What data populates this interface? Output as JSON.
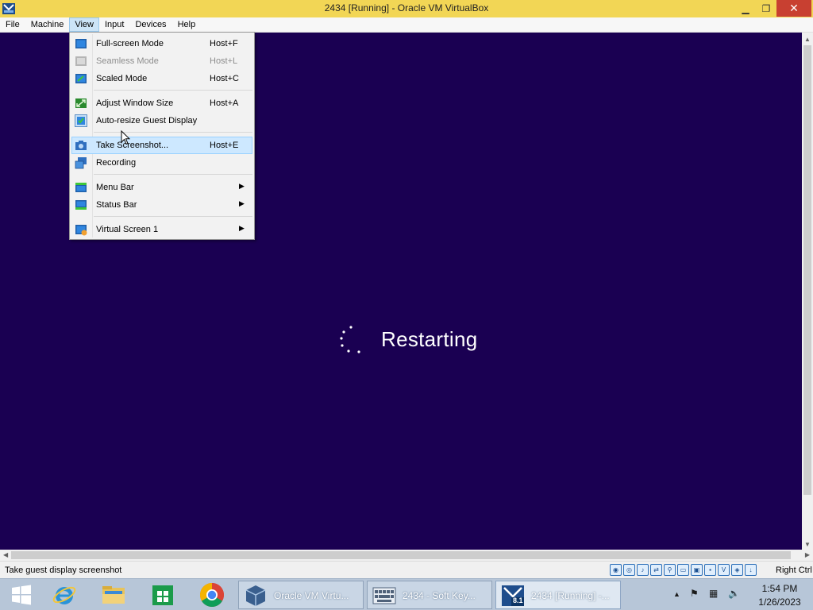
{
  "window": {
    "title": "2434 [Running] - Oracle VM VirtualBox",
    "minimize": "▁",
    "maximize": "❐",
    "close": "✕"
  },
  "menubar": {
    "items": [
      "File",
      "Machine",
      "View",
      "Input",
      "Devices",
      "Help"
    ],
    "active": "View"
  },
  "view_menu": {
    "fullscreen": {
      "label": "Full-screen Mode",
      "shortcut": "Host+F"
    },
    "seamless": {
      "label": "Seamless Mode",
      "shortcut": "Host+L"
    },
    "scaled": {
      "label": "Scaled Mode",
      "shortcut": "Host+C"
    },
    "adjust": {
      "label": "Adjust Window Size",
      "shortcut": "Host+A"
    },
    "autoresize": {
      "label": "Auto-resize Guest Display"
    },
    "screenshot": {
      "label": "Take Screenshot...",
      "shortcut": "Host+E"
    },
    "recording": {
      "label": "Recording"
    },
    "menu_bar": {
      "label": "Menu Bar"
    },
    "status_bar": {
      "label": "Status Bar"
    },
    "virtual_screen": {
      "label": "Virtual Screen 1"
    },
    "submenu_arrow": "▶"
  },
  "guest": {
    "message": "Restarting",
    "background": "#1a0052"
  },
  "statusbar": {
    "text": "Take guest display screenshot",
    "host_key": "Right Ctrl"
  },
  "taskbar": {
    "tasks": [
      {
        "label": "Oracle VM Virtu..."
      },
      {
        "label": "2434 - Soft Key..."
      },
      {
        "label": "2434 [Running] -..."
      }
    ],
    "clock_time": "1:54 PM",
    "clock_date": "1/26/2023",
    "vbox_badge": "8.1"
  },
  "colors": {
    "titlebar": "#f2d655",
    "close": "#c84031",
    "menu_highlight": "#cde8ff"
  }
}
